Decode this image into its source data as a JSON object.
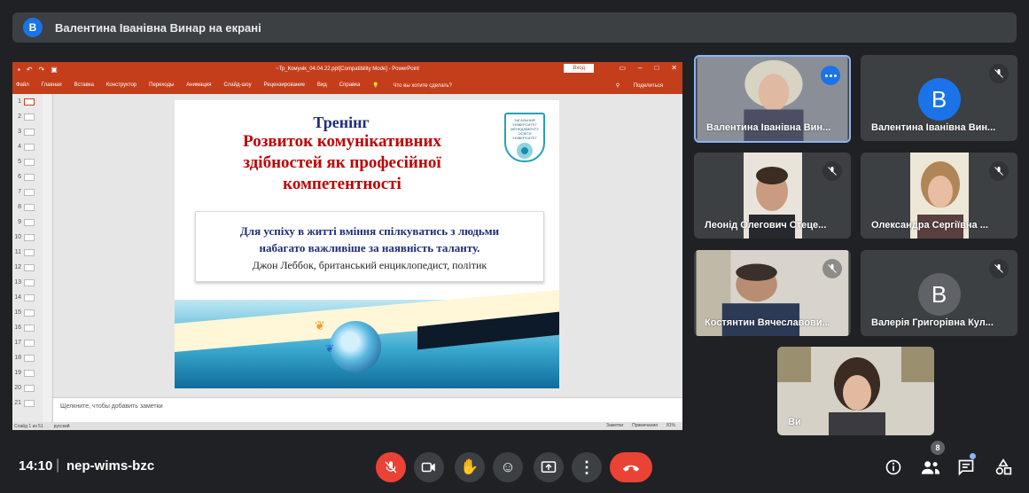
{
  "banner": {
    "avatar_letter": "B",
    "text": "Валентина Іванівна Винар на екрані"
  },
  "powerpoint": {
    "doc_title": "~Тр_Комунік_04.04.22.ppt[Compatibility Mode] - PowerPoint",
    "login_button": "Вход",
    "menu": [
      "Файл",
      "Главная",
      "Вставка",
      "Конструктор",
      "Переходы",
      "Анимация",
      "Слайд-шоу",
      "Рецензирование",
      "Вид",
      "Справка"
    ],
    "tell_me": "Что вы хотите сделать?",
    "share": "Поделиться",
    "thumb_numbers": [
      "1",
      "2",
      "3",
      "4",
      "5",
      "6",
      "7",
      "8",
      "9",
      "10",
      "11",
      "12",
      "13",
      "14",
      "15",
      "16",
      "17",
      "18",
      "19",
      "20",
      "21"
    ],
    "notes_placeholder": "Щелкните, чтобы добавить заметки",
    "status_left": "Слайд 1 из 51",
    "status_lang": "русский",
    "status_notes": "Заметки",
    "status_comments": "Примечания",
    "zoom": "81%"
  },
  "slide": {
    "title1": "Тренінг",
    "title2_line1": "Розвиток комунікативних",
    "title2_line2": "здібностей як професійної",
    "title2_line3": "компетентності",
    "logo_text": "ЗАГАЛЬНИЙ УНІВЕРСИТЕТ МЕНЕДЖМЕНТУ ОСВІТИ",
    "logo_name": "УНІВЕРСИТЕТ",
    "quote_line1": "Для успіху в житті вміння спілкуватись з людьми",
    "quote_line2": "набагато важливіше за наявність таланту.",
    "quote_author": "Джон Леббок, британський енциклопедист, політик"
  },
  "participants": [
    {
      "name": "Валентина Іванівна Вин...",
      "type": "video",
      "speaking": true
    },
    {
      "name": "Валентина Іванівна Вин...",
      "type": "avatar",
      "letter": "B",
      "avatar_color": "#1a73e8",
      "muted": true
    },
    {
      "name": "Леонід Олегович Стеце...",
      "type": "video",
      "muted": true
    },
    {
      "name": "Олександра Сергіївна ...",
      "type": "video",
      "muted": true
    },
    {
      "name": "Костянтин Вячеславови...",
      "type": "video",
      "muted": true
    },
    {
      "name": "Валерія Григорівна Кул...",
      "type": "avatar",
      "letter": "B",
      "avatar_color": "#5f6368",
      "muted": true
    },
    {
      "name": "Ви",
      "type": "video",
      "muted": false
    }
  ],
  "bottom_bar": {
    "time": "14:10",
    "separator": "|",
    "meeting_code": "nep-wims-bzc",
    "participant_count": "8"
  },
  "colors": {
    "background": "#202124",
    "surface": "#3c4043",
    "accent_blue": "#1a73e8",
    "danger_red": "#ea4335",
    "ppt_orange": "#c43e1c"
  }
}
